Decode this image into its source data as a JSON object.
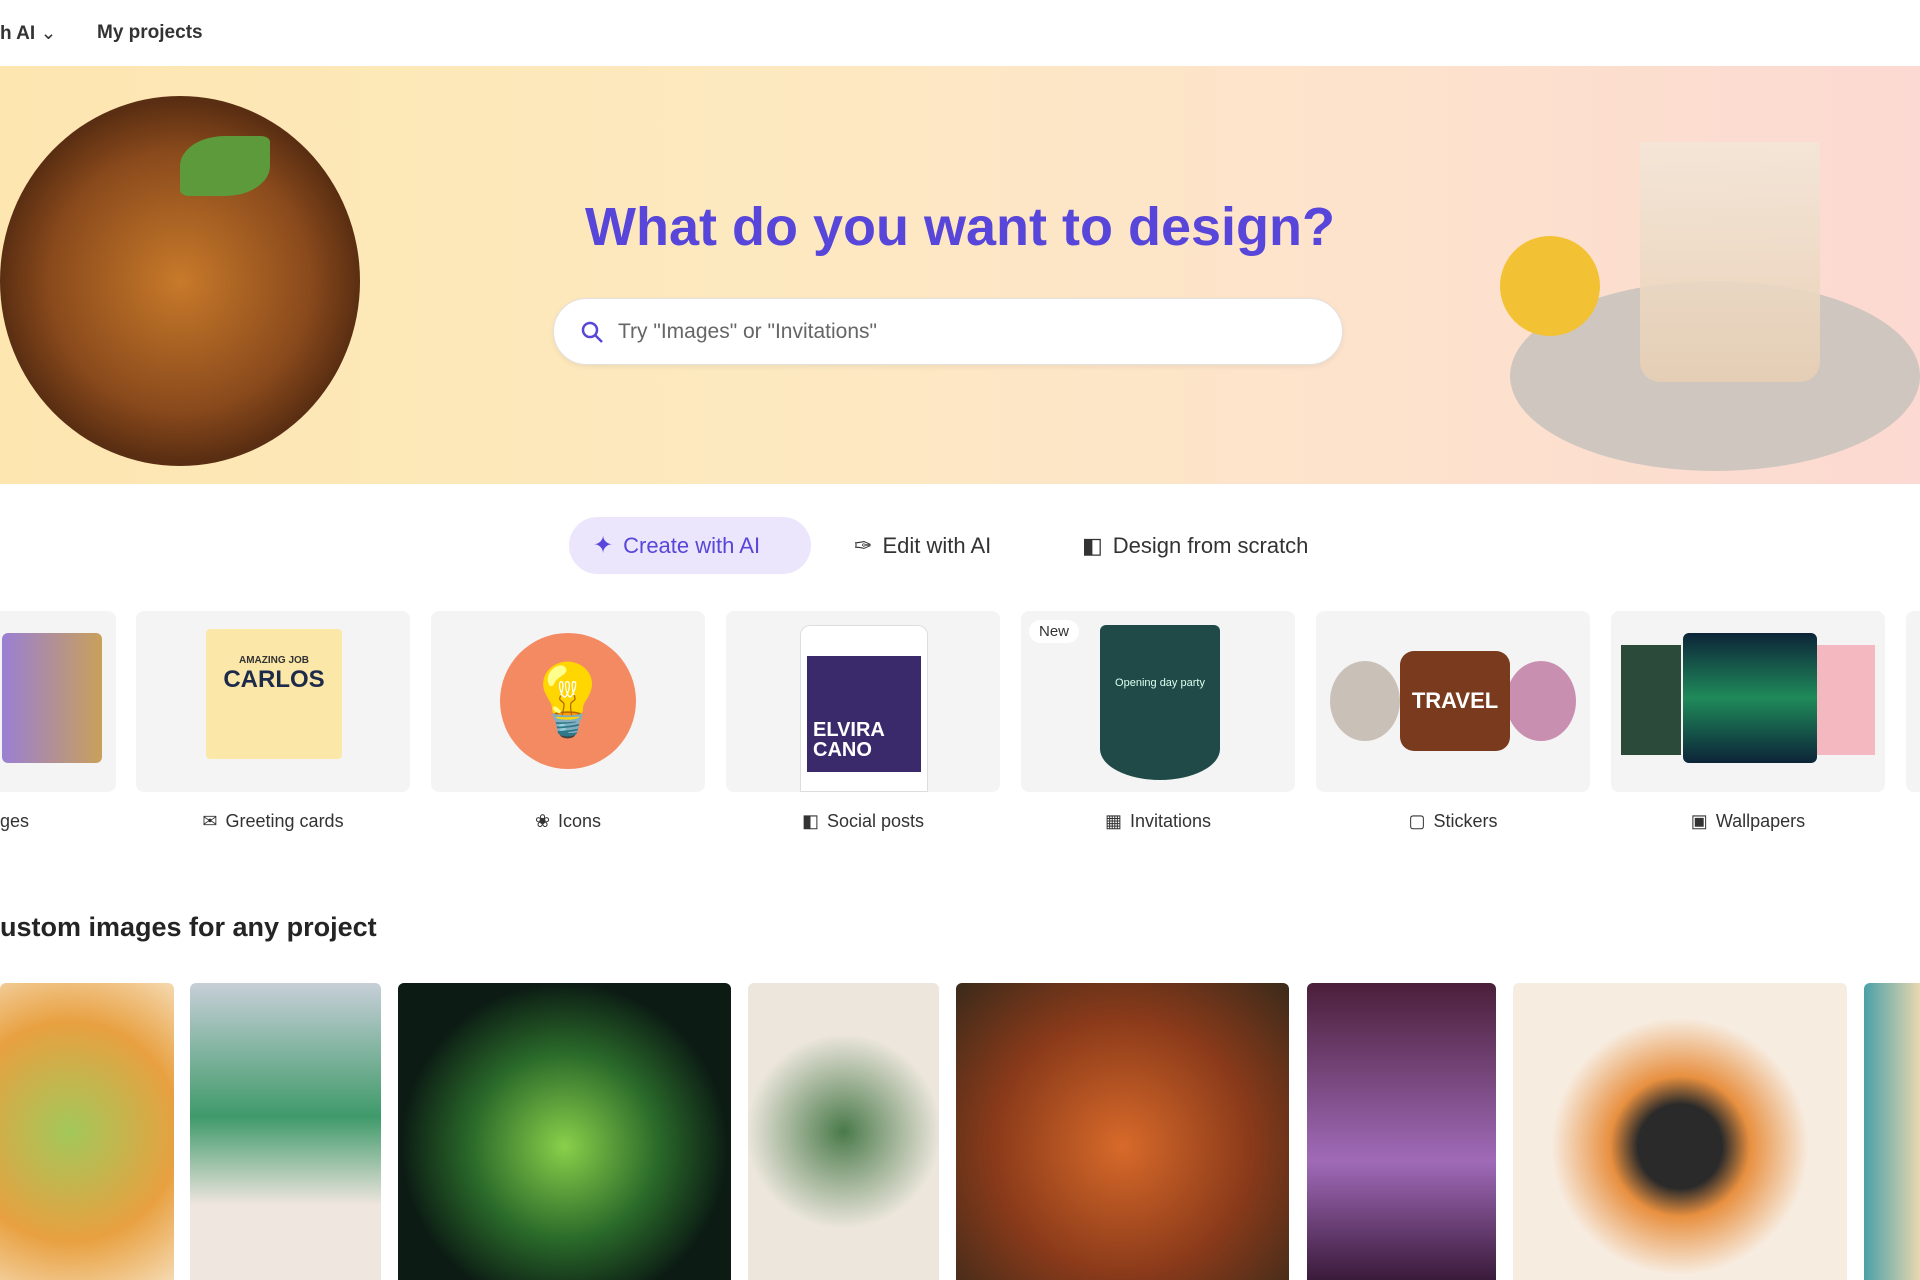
{
  "nav": {
    "items": [
      {
        "label": "h AI",
        "has_chevron": true
      },
      {
        "label": "My projects"
      }
    ]
  },
  "hero": {
    "title": "What do you want to design?",
    "search_placeholder": "Try \"Images\" or \"Invitations\""
  },
  "tabs": [
    {
      "label": "Create with AI",
      "icon": "sparkle-icon",
      "active": true
    },
    {
      "label": "Edit with AI",
      "icon": "magic-wand-icon"
    },
    {
      "label": "Design from scratch",
      "icon": "shapes-icon"
    }
  ],
  "categories": [
    {
      "label": "ges",
      "icon": "image-icon"
    },
    {
      "label": "Greeting cards",
      "icon": "envelope-icon"
    },
    {
      "label": "Icons",
      "icon": "icons-icon"
    },
    {
      "label": "Social posts",
      "icon": "social-icon"
    },
    {
      "label": "Invitations",
      "icon": "calendar-icon",
      "badge": "New"
    },
    {
      "label": "Stickers",
      "icon": "sticker-icon"
    },
    {
      "label": "Wallpapers",
      "icon": "wallpaper-icon"
    }
  ],
  "card_text": {
    "greeting": "AMAZING JOB",
    "greeting_name": "CARLOS",
    "social": "ELVIRA CANO",
    "invitation": "Opening day party",
    "sticker": "TRAVEL"
  },
  "section": {
    "title": "ustom images for any project"
  },
  "colors": {
    "accent": "#5746d9",
    "active_tab_bg": "#ebe6fb"
  }
}
